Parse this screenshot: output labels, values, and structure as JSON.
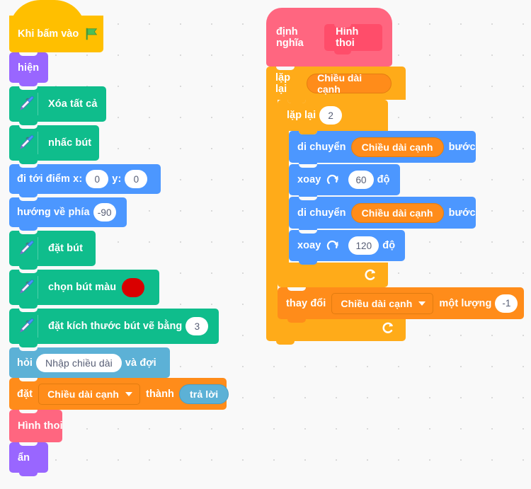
{
  "workspace": {
    "background_color": "#f9f9f9",
    "grid_dot_color": "#d9d9d9"
  },
  "palette_colors": {
    "events": "#ffbf00",
    "looks": "#9966ff",
    "pen": "#0fbd8c",
    "motion": "#4c97ff",
    "sensing": "#5cb1d6",
    "variables": "#ff8c1a",
    "my_blocks": "#ff6680",
    "control": "#ffab19",
    "pen_color_swatch": "#d90000"
  },
  "main_script": {
    "hat": {
      "label": "Khi bấm vào",
      "icon": "green-flag-icon"
    },
    "blocks": [
      {
        "id": "show",
        "label": "hiện"
      },
      {
        "id": "erase-all",
        "label": "Xóa tất cả",
        "icon": "pen-icon"
      },
      {
        "id": "pen-up",
        "label": "nhấc bút",
        "icon": "pen-icon"
      },
      {
        "id": "goto-xy",
        "label_x": "đi tới điểm x:",
        "value_x": "0",
        "label_y": "y:",
        "value_y": "0"
      },
      {
        "id": "point-dir",
        "label": "hướng về phía",
        "value": "-90"
      },
      {
        "id": "pen-down",
        "label": "đặt bút",
        "icon": "pen-icon"
      },
      {
        "id": "set-pen-color",
        "label": "chọn bút màu",
        "icon": "pen-icon",
        "color": "#d90000"
      },
      {
        "id": "set-pen-size",
        "label": "đặt kích thước bút vẽ bằng",
        "icon": "pen-icon",
        "value": "3"
      },
      {
        "id": "ask-wait",
        "label_pre": "hỏi",
        "value": "Nhập chiều dài",
        "label_post": "và đợi"
      },
      {
        "id": "set-var",
        "label_pre": "đặt",
        "variable": "Chiều dài cạnh",
        "label_mid": "thành",
        "reporter": "trả lời"
      },
      {
        "id": "call-custom",
        "label": "Hình thoi"
      },
      {
        "id": "hide",
        "label": "ẩn"
      }
    ]
  },
  "definition_script": {
    "define": {
      "label": "định nghĩa",
      "proto_label": "Hình thoi"
    },
    "outer_loop": {
      "label": "lặp lại",
      "times_variable": "Chiều dài cạnh",
      "loop_icon": "loop-arrow-icon"
    },
    "inner_loop": {
      "label": "lặp lại",
      "times": "2",
      "loop_icon": "loop-arrow-icon"
    },
    "inner_blocks": [
      {
        "id": "move-1",
        "label_pre": "di chuyển",
        "variable": "Chiều dài cạnh",
        "label_post": "bước"
      },
      {
        "id": "turn-1",
        "label_pre": "xoay",
        "icon": "turn-right-icon",
        "value": "60",
        "label_post": "độ"
      },
      {
        "id": "move-2",
        "label_pre": "di chuyển",
        "variable": "Chiều dài cạnh",
        "label_post": "bước"
      },
      {
        "id": "turn-2",
        "label_pre": "xoay",
        "icon": "turn-right-icon",
        "value": "120",
        "label_post": "độ"
      }
    ],
    "change_var": {
      "label_pre": "thay đổi",
      "variable": "Chiều dài cạnh",
      "label_mid": "một lượng",
      "value": "-1"
    }
  }
}
